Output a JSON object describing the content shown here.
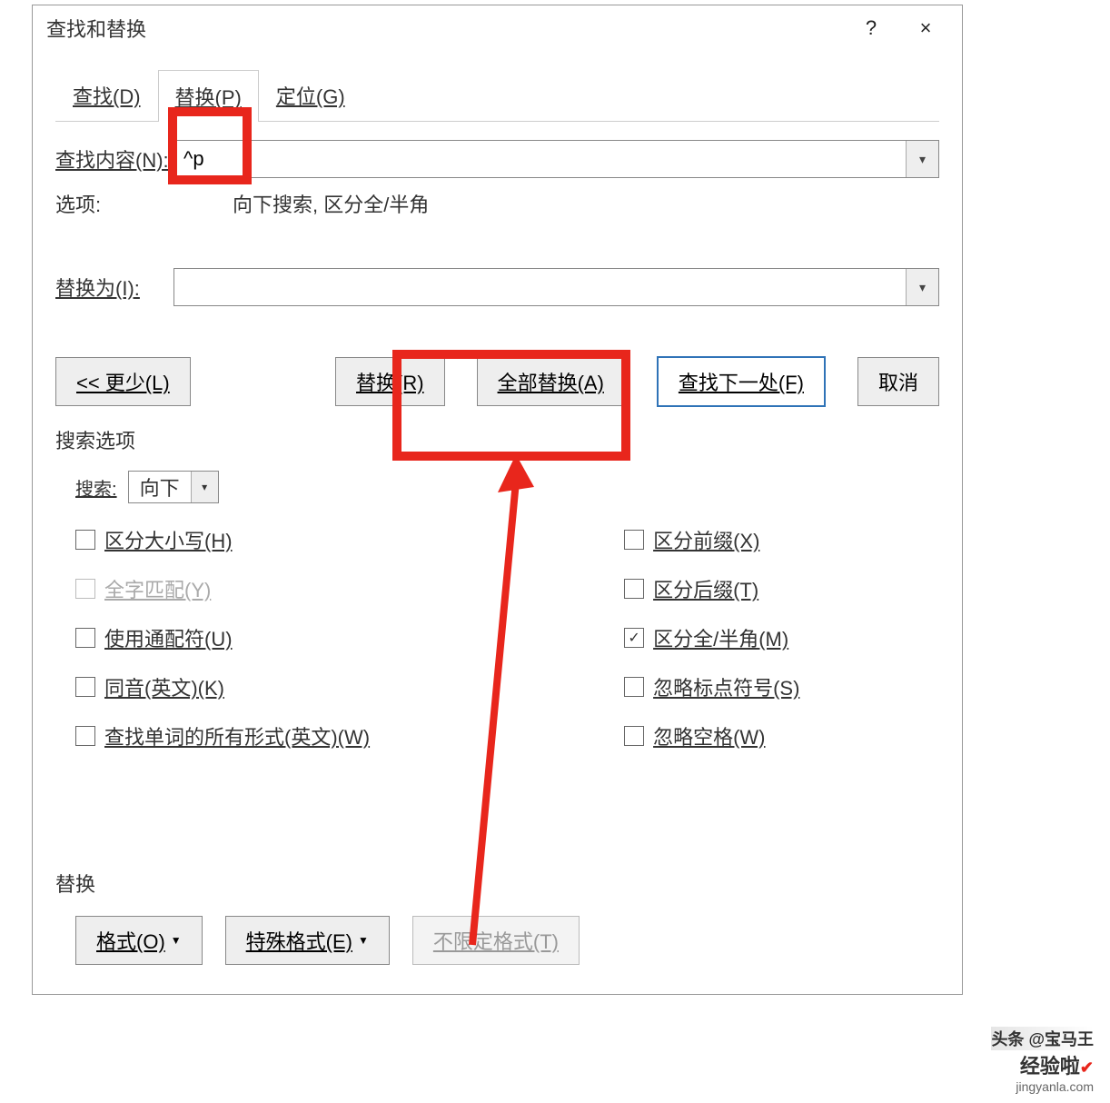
{
  "titlebar": {
    "title": "查找和替换",
    "help": "?",
    "close": "×"
  },
  "tabs": {
    "find": "查找(D)",
    "replace": "替换(P)",
    "goto": "定位(G)"
  },
  "fields": {
    "find_label": "查找内容(N):",
    "find_value": "^p",
    "options_label": "选项:",
    "options_value": "向下搜索, 区分全/半角",
    "replace_label": "替换为(I):",
    "replace_value": ""
  },
  "buttons": {
    "less": "<< 更少(L)",
    "replace": "替换(R)",
    "replace_all": "全部替换(A)",
    "find_next": "查找下一处(F)",
    "cancel": "取消"
  },
  "search_options": {
    "legend": "搜索选项",
    "direction_label": "搜索:",
    "direction_value": "向下",
    "left": {
      "match_case": "区分大小写(H)",
      "whole_word": "全字匹配(Y)",
      "wildcards": "使用通配符(U)",
      "sounds_like": "同音(英文)(K)",
      "all_forms": "查找单词的所有形式(英文)(W)"
    },
    "right": {
      "prefix": "区分前缀(X)",
      "suffix": "区分后缀(T)",
      "fullhalf": "区分全/半角(M)",
      "ignore_punct": "忽略标点符号(S)",
      "ignore_space": "忽略空格(W)"
    },
    "fullhalf_checked": true
  },
  "bottom": {
    "legend": "替换",
    "format": "格式(O)",
    "special": "特殊格式(E)",
    "no_format": "不限定格式(T)"
  },
  "watermark": {
    "line1": "头条 @宝马王",
    "brand": "经验啦",
    "domain": "jingyanla.com"
  }
}
